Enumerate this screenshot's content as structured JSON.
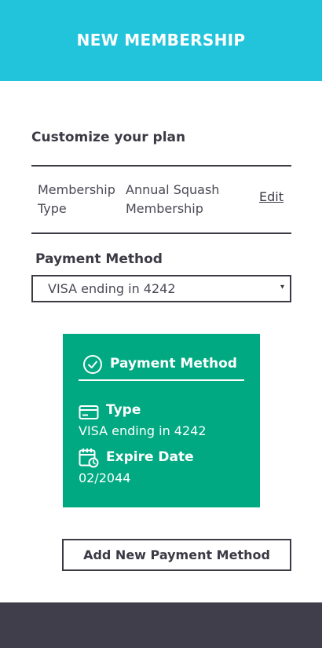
{
  "header": {
    "title": "NEW MEMBERSHIP"
  },
  "plan": {
    "section_title": "Customize your plan",
    "membership_type_label": "Membership Type",
    "membership_type_value": "Annual Squash Membership",
    "edit_label": "Edit"
  },
  "payment": {
    "label": "Payment Method",
    "selected_value": "VISA ending in 4242",
    "arrow_glyph": "▾"
  },
  "card": {
    "title": "Payment Method",
    "type_label": "Type",
    "type_value": "VISA ending in 4242",
    "expire_label": "Expire Date",
    "expire_value": "02/2044"
  },
  "actions": {
    "add_payment_label": "Add New Payment Method"
  },
  "colors": {
    "header_bg": "#22c4dc",
    "card_bg": "#00a982",
    "footer_bg": "#413e4b",
    "text_dark": "#3b3a45"
  },
  "icons": {
    "card_header": "check-circle-icon",
    "type": "credit-card-icon",
    "expire": "calendar-clock-icon"
  }
}
